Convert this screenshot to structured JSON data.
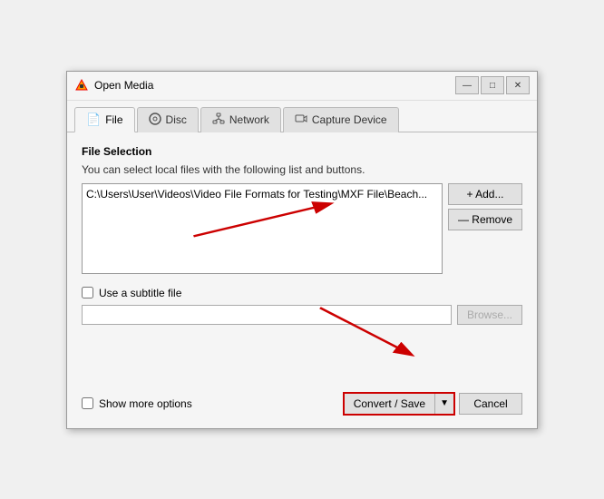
{
  "window": {
    "title": "Open Media",
    "title_icon": "🔺"
  },
  "title_controls": {
    "minimize": "—",
    "maximize": "□",
    "close": "✕"
  },
  "tabs": [
    {
      "id": "file",
      "label": "File",
      "icon": "📄",
      "active": true
    },
    {
      "id": "disc",
      "label": "Disc",
      "icon": "💿",
      "active": false
    },
    {
      "id": "network",
      "label": "Network",
      "icon": "🖧",
      "active": false
    },
    {
      "id": "capture",
      "label": "Capture Device",
      "icon": "🖥",
      "active": false
    }
  ],
  "file_tab": {
    "section_label": "File Selection",
    "description": "You can select local files with the following list and buttons.",
    "file_path": "C:\\Users\\User\\Videos\\Video File Formats for Testing\\MXF File\\Beach...",
    "add_button": "+ Add...",
    "remove_button": "— Remove",
    "subtitle_checkbox_label": "Use a subtitle file",
    "subtitle_placeholder": "",
    "browse_button": "Browse..."
  },
  "footer": {
    "show_more_label": "Show more options",
    "convert_save_label": "Convert / Save",
    "dropdown_arrow": "▼",
    "cancel_label": "Cancel"
  }
}
